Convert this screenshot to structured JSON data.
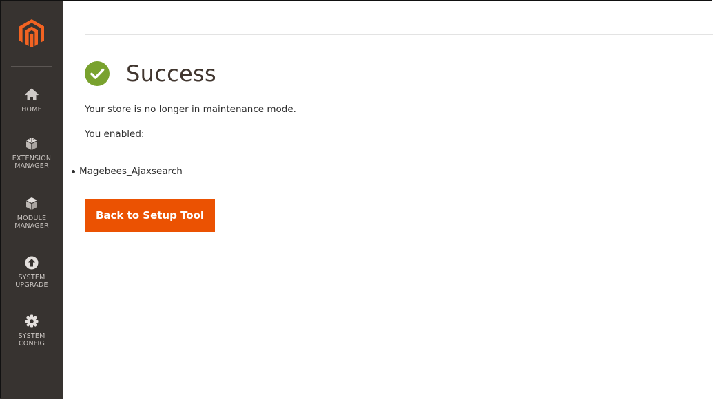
{
  "sidebar": {
    "logo_icon": "magento-logo-icon",
    "brand_color": "#f26322",
    "items": [
      {
        "label": "HOME",
        "icon": "home-icon"
      },
      {
        "label": "EXTENSION\nMANAGER",
        "icon": "extension-manager-icon"
      },
      {
        "label": "MODULE\nMANAGER",
        "icon": "module-manager-icon"
      },
      {
        "label": "SYSTEM\nUPGRADE",
        "icon": "system-upgrade-icon"
      },
      {
        "label": "SYSTEM\nCONFIG",
        "icon": "gear-icon"
      }
    ]
  },
  "main": {
    "title": "Success",
    "status_icon": "check-circle-icon",
    "status_color": "#79a22e",
    "message": "Your store is no longer in maintenance mode.",
    "enabled_label": "You enabled:",
    "modules": [
      "Magebees_Ajaxsearch"
    ],
    "back_button_label": "Back to Setup Tool",
    "accent_color": "#eb5202"
  }
}
